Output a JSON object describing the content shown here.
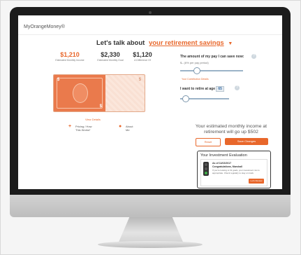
{
  "app": {
    "brand": "MyOrangeMoney®"
  },
  "header": {
    "lead": "Let's talk about",
    "highlight": "your retirement savings",
    "chevron_icon": "chevron-down-icon"
  },
  "stats": [
    {
      "value": "$1,210",
      "label": "Estimated Monthly Income",
      "color": "#e8672b"
    },
    {
      "value": "$2,330",
      "label": "Estimated Monthly Goal",
      "color": "#333333"
    },
    {
      "value": "$1,120",
      "label": "A Difference Of",
      "color": "#333333"
    }
  ],
  "bill": {
    "denomination": "$"
  },
  "details": {
    "view_details": "View Details",
    "options": [
      {
        "icon": "plus-icon",
        "lines": [
          "Pricing / How",
          "This Works*"
        ]
      },
      {
        "icon": "person-icon",
        "lines": [
          "About",
          "Me"
        ]
      }
    ]
  },
  "controls": {
    "save_label": "The amount of my pay I can save now:",
    "save_sub": "$– (6% per pay period)",
    "save_slider_value_percent": 25,
    "contribution_link": "Your Contribution Details",
    "age_label": "I want to retire at age",
    "age_value": "65",
    "age_slider_value_percent": 10
  },
  "result": {
    "line1": "Your estimated monthly income at",
    "line2": "retirement will go up $502"
  },
  "buttons": {
    "reset": "Reset",
    "save": "Save Changes"
  },
  "evaluation": {
    "title": "Your Investment Evaluation",
    "date": "As of 11/02/2017",
    "congrats": "Congratulations, Marshall",
    "message": "If you're looking to hit goals, your investment mix is appropriate. Check regularly to stay on track.",
    "button": "Let's Review",
    "light_colors": [
      "#555555",
      "#555555",
      "#3fae49"
    ]
  },
  "colors": {
    "accent": "#e8672b",
    "bezel": "#1c1c1c"
  }
}
